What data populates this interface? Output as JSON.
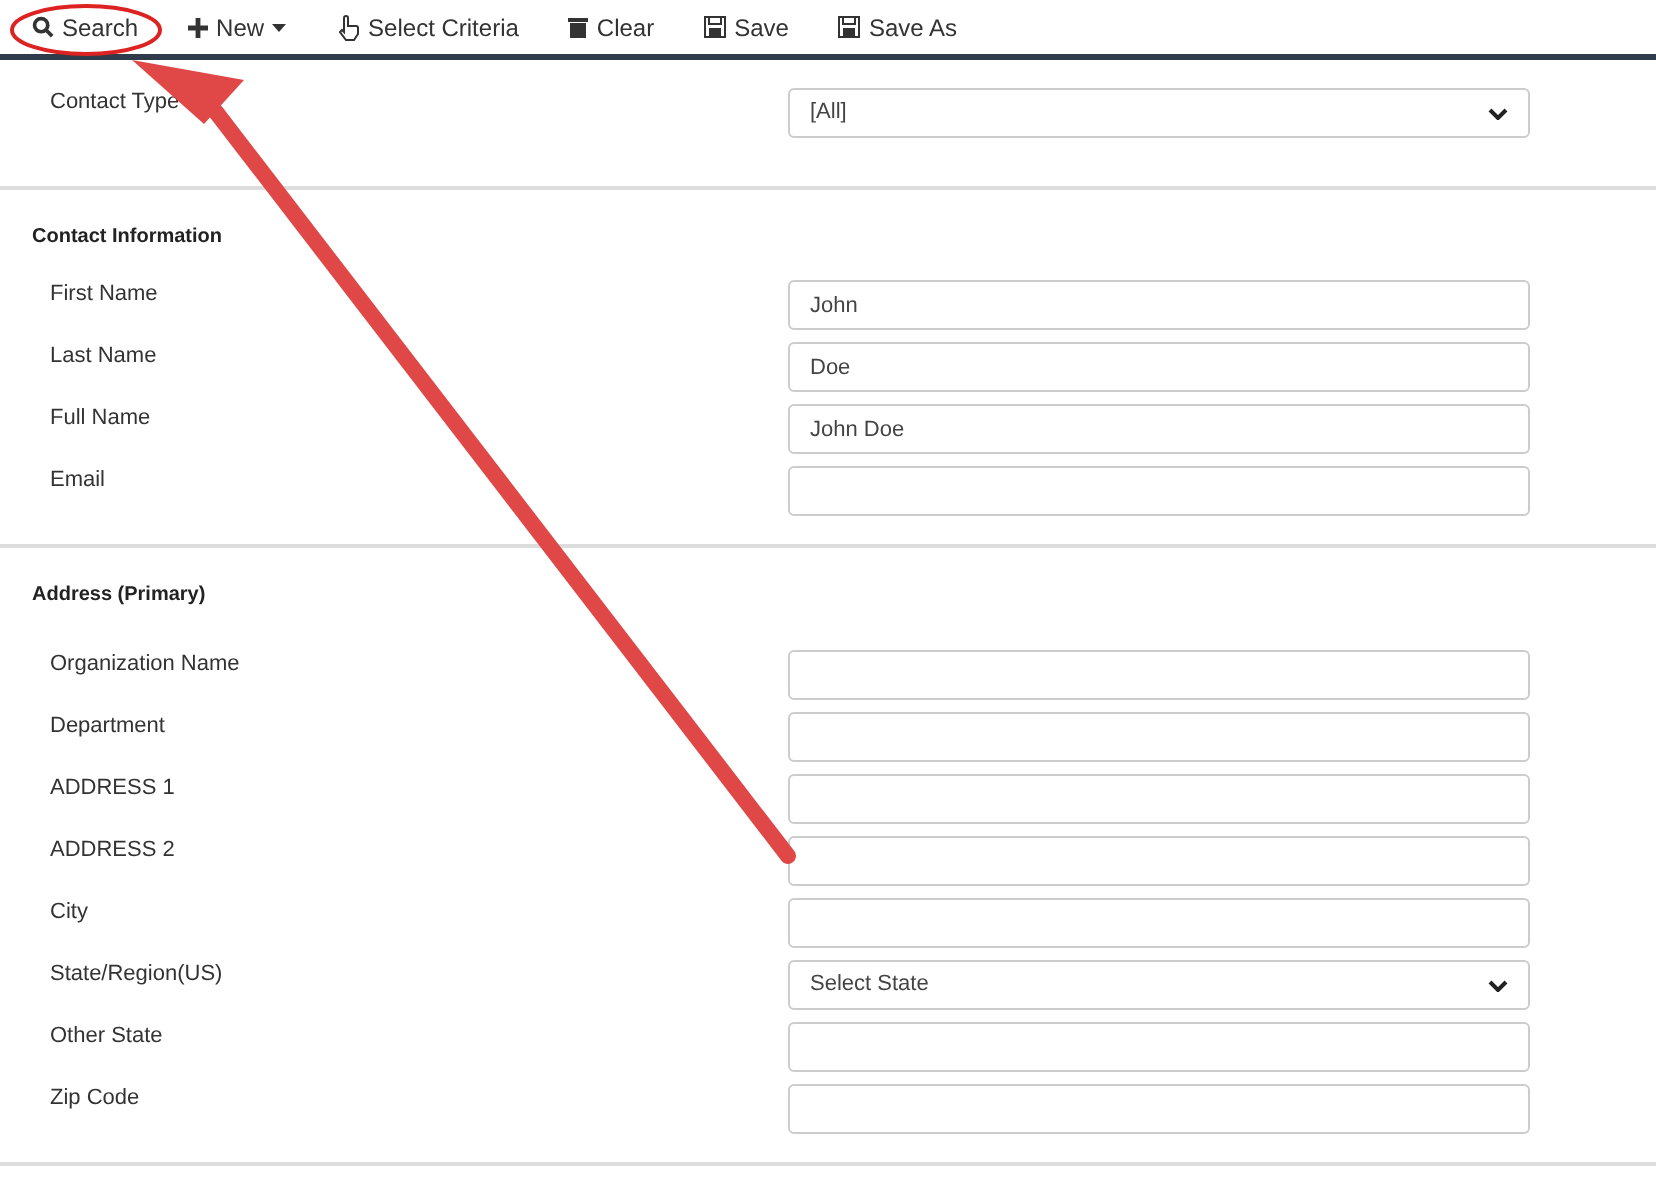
{
  "toolbar": [
    {
      "label": "Search",
      "has_menu": false
    },
    {
      "label": "New",
      "has_menu": true
    },
    {
      "label": "Select Criteria",
      "has_menu": false
    },
    {
      "label": "Clear",
      "has_menu": false
    },
    {
      "label": "Save",
      "has_menu": false
    },
    {
      "label": "Save As",
      "has_menu": false
    }
  ],
  "sections": [
    {
      "fields": [
        {
          "label": "Contact Type",
          "kind": "select",
          "value": "[All]"
        }
      ]
    },
    {
      "title": "Contact Information",
      "fields": [
        {
          "label": "First Name",
          "kind": "text",
          "value": "John"
        },
        {
          "label": "Last Name",
          "kind": "text",
          "value": "Doe"
        },
        {
          "label": "Full Name",
          "kind": "text",
          "value": "John Doe"
        },
        {
          "label": "Email",
          "kind": "text"
        }
      ]
    },
    {
      "title": "Address (Primary)",
      "fields": [
        {
          "label": "Organization Name",
          "kind": "text"
        },
        {
          "label": "Department",
          "kind": "text"
        },
        {
          "label": "ADDRESS 1",
          "kind": "text"
        },
        {
          "label": "ADDRESS 2",
          "kind": "text"
        },
        {
          "label": "City",
          "kind": "text"
        },
        {
          "label": "State/Region(US)",
          "kind": "select",
          "value": "Select State"
        },
        {
          "label": "Other State",
          "kind": "text"
        },
        {
          "label": "Zip Code",
          "kind": "text"
        }
      ]
    }
  ]
}
